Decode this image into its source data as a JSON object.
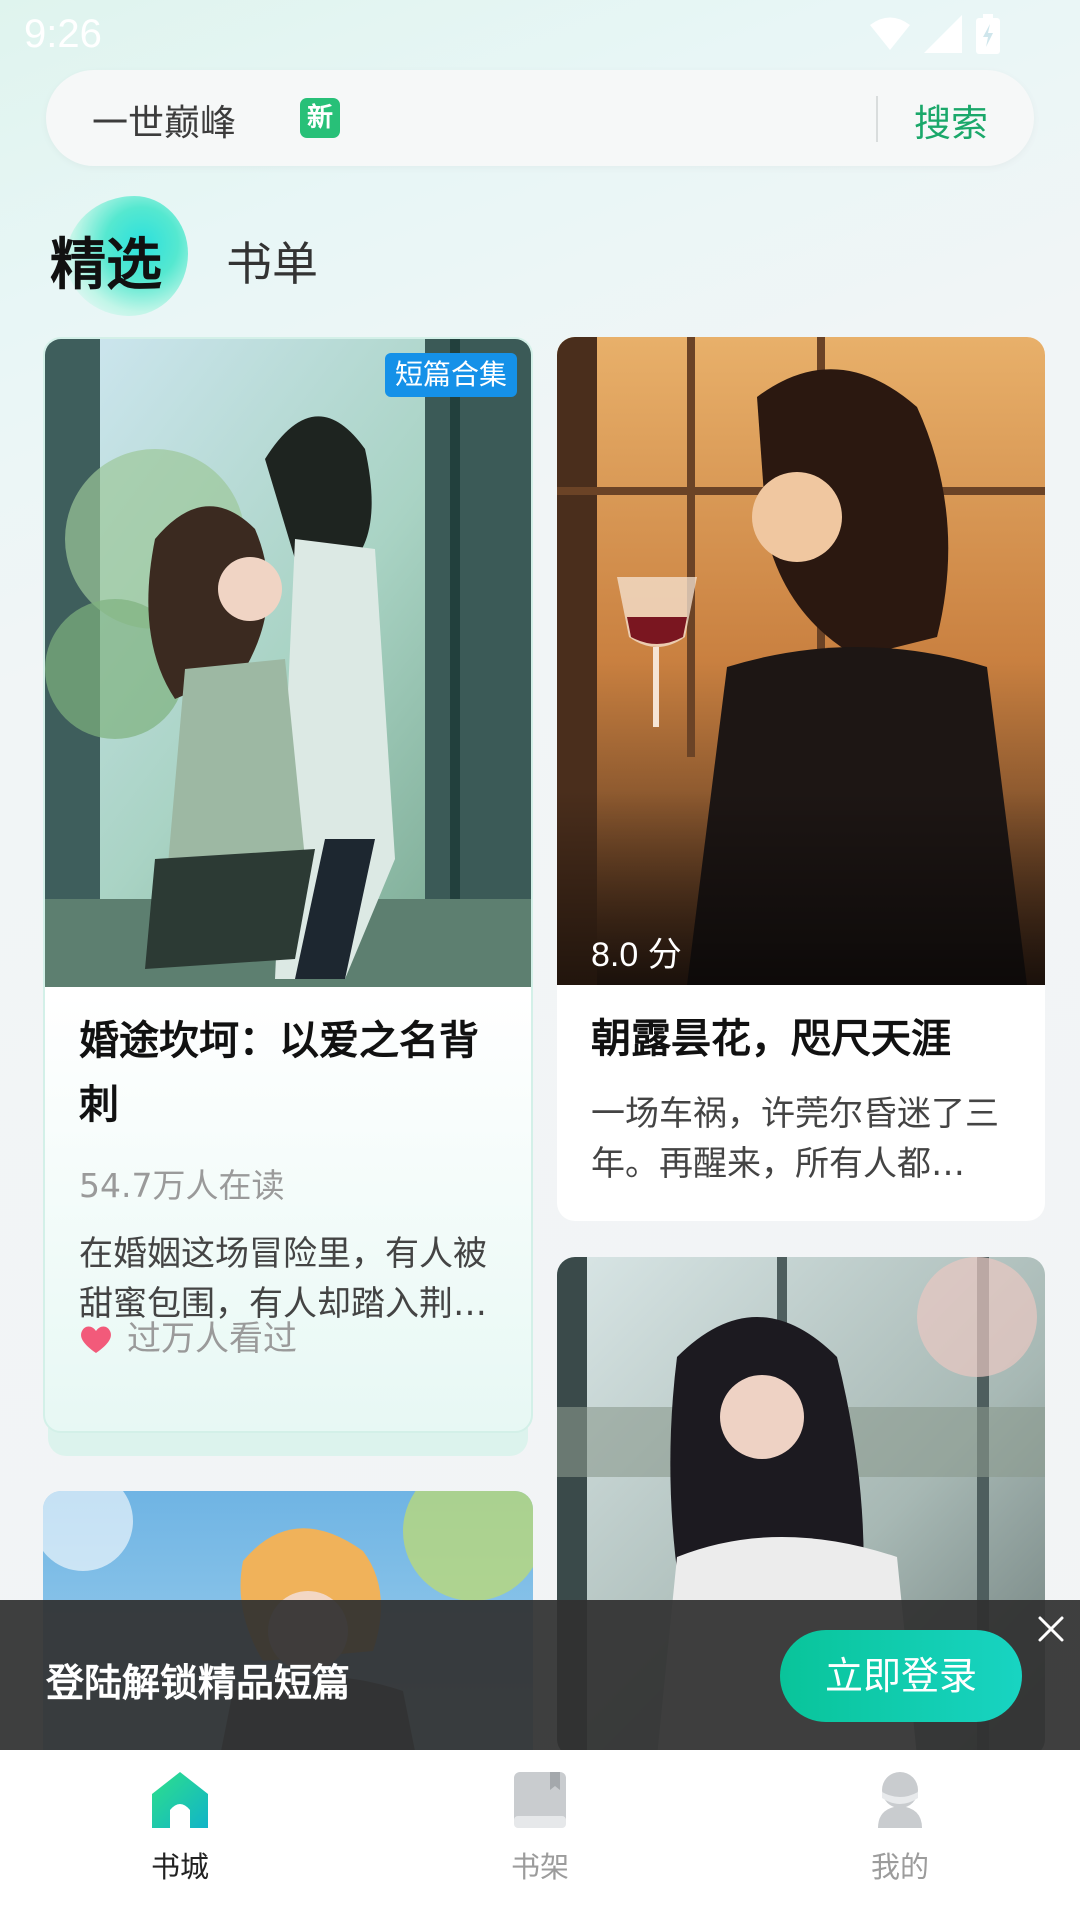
{
  "status_bar": {
    "time": "9:26"
  },
  "search": {
    "query": "一世巅峰",
    "badge": "新",
    "button": "搜索"
  },
  "tabs": {
    "selected": "精选",
    "other": "书单"
  },
  "cards": [
    {
      "tag": "短篇合集",
      "title": "婚途坎坷：以爱之名背刺",
      "readers": "54.7万人在读",
      "description": "在婚姻这场冒险里，有人被甜蜜包围，有人却踏入荆棘丛林……",
      "heat": "过万人看过"
    },
    {
      "score": "8.0 分",
      "title": "朝露昙花，咫尺天涯",
      "description": "一场车祸，许莞尔昏迷了三年。再醒来，所有人都说……"
    }
  ],
  "login_banner": {
    "text": "登陆解锁精品短篇",
    "button": "立即登录"
  },
  "bottom_nav": [
    {
      "label": "书城",
      "icon": "home-icon",
      "active": true
    },
    {
      "label": "书架",
      "icon": "book-icon",
      "active": false
    },
    {
      "label": "我的",
      "icon": "profile-icon",
      "active": false
    }
  ],
  "colors": {
    "accent": "#1aa86a",
    "tag_blue": "#1591e8",
    "login_gradient": "#09c49a"
  }
}
